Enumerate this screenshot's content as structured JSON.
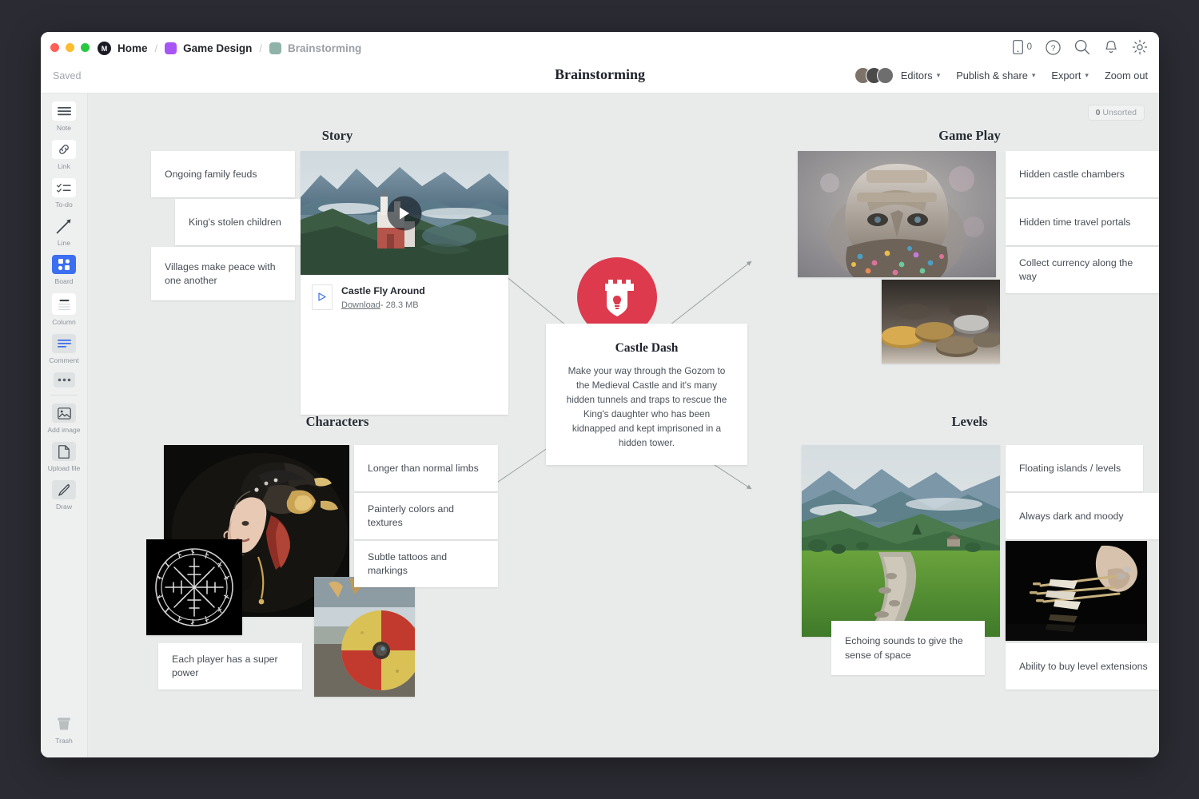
{
  "header": {
    "breadcrumb": [
      {
        "label": "Home",
        "type": "logo",
        "muted": false
      },
      {
        "label": "Game Design",
        "type": "swatch",
        "color": "#a855f7",
        "muted": false
      },
      {
        "label": "Brainstorming",
        "type": "swatch",
        "color": "#8fb3a9",
        "muted": true
      }
    ],
    "separator": "/",
    "saved_status": "Saved",
    "document_title": "Brainstorming",
    "icons": [
      {
        "name": "mobile-icon",
        "count": "0"
      },
      {
        "name": "help-icon"
      },
      {
        "name": "search-icon"
      },
      {
        "name": "notifications-icon"
      },
      {
        "name": "settings-icon"
      }
    ],
    "actions": {
      "editors": "Editors",
      "publish": "Publish & share",
      "export": "Export",
      "zoom_out": "Zoom out"
    }
  },
  "sidebar": {
    "tools": [
      {
        "label": "Note",
        "icon": "note-icon",
        "active": false
      },
      {
        "label": "Link",
        "icon": "link-icon",
        "active": false
      },
      {
        "label": "To-do",
        "icon": "todo-icon",
        "active": false
      },
      {
        "label": "Line",
        "icon": "line-icon",
        "active": false
      },
      {
        "label": "Board",
        "icon": "board-icon",
        "active": true
      },
      {
        "label": "Column",
        "icon": "column-icon",
        "active": false
      },
      {
        "label": "Comment",
        "icon": "comment-icon",
        "active": false
      },
      {
        "label": "",
        "icon": "more-icon",
        "active": false
      }
    ],
    "tools2": [
      {
        "label": "Add image",
        "icon": "image-icon"
      },
      {
        "label": "Upload file",
        "icon": "file-icon"
      },
      {
        "label": "Draw",
        "icon": "pen-icon"
      }
    ],
    "trash": {
      "label": "Trash",
      "icon": "trash-icon"
    }
  },
  "canvas": {
    "unsorted_count": "0",
    "unsorted_label": "Unsorted",
    "hub": {
      "title": "Castle Dash",
      "description": "Make your way through the Gozom to the Medieval Castle and it's many hidden tunnels and traps to rescue the King's daughter who has been kidnapped and kept imprisoned in a hidden tower.",
      "logo_color": "#dd3a4e",
      "logo_icon": "castle-shield-logo"
    },
    "sections": [
      {
        "title": "Story",
        "notes": [
          "Ongoing family feuds",
          "King's stolen children",
          "Villages make peace with one another"
        ],
        "video": {
          "title": "Castle Fly Around",
          "download_label": "Download",
          "size": "28.3 MB",
          "separator": "-"
        }
      },
      {
        "title": "Game Play",
        "notes": [
          "Hidden castle chambers",
          "Hidden time travel portals",
          "Collect currency along the way"
        ]
      },
      {
        "title": "Characters",
        "notes": [
          "Longer than normal limbs",
          "Painterly colors and textures",
          "Subtle tattoos and markings",
          "Each player has a super power"
        ]
      },
      {
        "title": "Levels",
        "notes": [
          "Floating islands / levels",
          "Always dark and moody",
          "Echoing sounds to give the sense of space",
          "Ability to buy level extensions"
        ]
      }
    ]
  }
}
